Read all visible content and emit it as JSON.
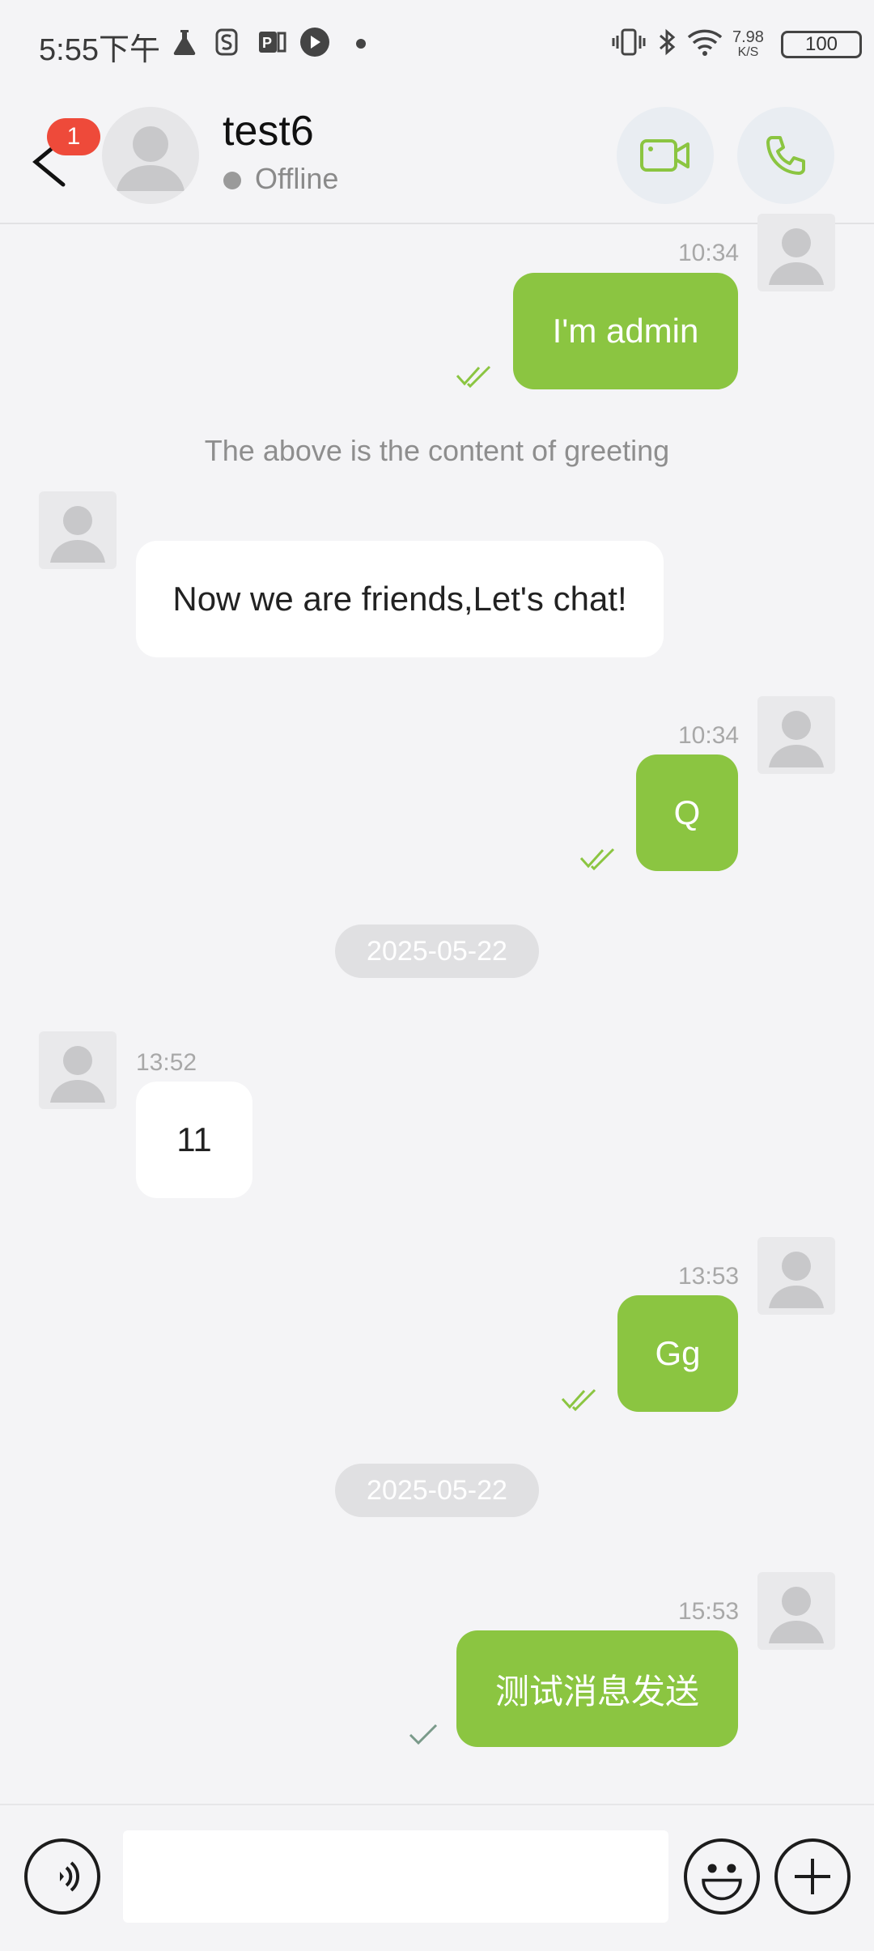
{
  "status_bar": {
    "time": "5:55下午",
    "net_speed_value": "7.98",
    "net_speed_unit": "K/S",
    "battery": "100"
  },
  "header": {
    "back_badge": "1",
    "contact_name": "test6",
    "contact_status": "Offline"
  },
  "messages": {
    "m1": {
      "time": "10:34",
      "text": "I'm admin"
    },
    "greeting_note": "The above is the content of greeting",
    "m2": {
      "text": "Now we are friends,Let's chat!"
    },
    "m3": {
      "time": "10:34",
      "text": "Q"
    },
    "date1": "2025-05-22",
    "m4": {
      "time": "13:52",
      "text": "11"
    },
    "m5": {
      "time": "13:53",
      "text": "Gg"
    },
    "date2": "2025-05-22",
    "m6": {
      "time": "15:53",
      "text": "测试消息发送"
    }
  },
  "composer": {
    "input_value": "",
    "input_placeholder": ""
  },
  "colors": {
    "outgoing_bubble": "#8bc541",
    "incoming_bubble": "#ffffff",
    "badge": "#ee4a3a",
    "accent_icon": "#8bc541"
  },
  "icons": [
    "back-icon",
    "video-call-icon",
    "phone-icon",
    "voice-icon",
    "emoji-icon",
    "plus-icon",
    "double-check-icon",
    "single-check-icon",
    "avatar-placeholder-icon"
  ]
}
